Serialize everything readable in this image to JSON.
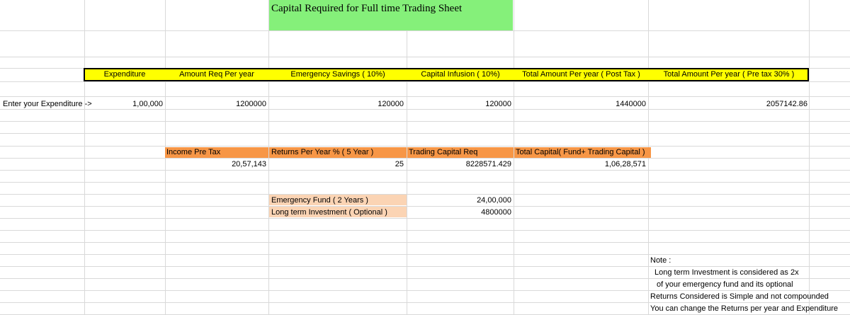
{
  "title": "Capital Required for Full time Trading Sheet",
  "header_row": {
    "expenditure": "Expenditure",
    "amount_req_per_year": "Amount Req Per year",
    "emergency_savings": "Emergency Savings ( 10%)",
    "capital_infusion": "Capital Infusion ( 10%)",
    "total_post_tax": "Total Amount Per year ( Post Tax )",
    "total_pre_tax": "Total Amount Per year ( Pre tax 30% )"
  },
  "values_row": {
    "label": "Enter your Expenditure ->",
    "expenditure": "1,00,000",
    "amount_req_per_year": "1200000",
    "emergency_savings": "120000",
    "capital_infusion": "120000",
    "total_post_tax": "1440000",
    "total_pre_tax": "2057142.86"
  },
  "second_header": {
    "income_pre_tax": "Income Pre Tax",
    "returns_per_year": "Returns Per Year % ( 5 Year )",
    "trading_capital_req": "Trading Capital  Req",
    "total_capital": "Total Capital( Fund+ Trading Capital )"
  },
  "second_values": {
    "income_pre_tax": "20,57,143",
    "returns_per_year": "25",
    "trading_capital_req": "8228571.429",
    "total_capital": "1,06,28,571"
  },
  "funds": {
    "emergency_label": "Emergency Fund ( 2 Years )",
    "emergency_value": "24,00,000",
    "longterm_label": "Long term Investment ( Optional )",
    "longterm_value": "4800000"
  },
  "notes": {
    "heading": "Note :",
    "line1": "Long term Investment is considered as 2x",
    "line2": "of your emergency fund and its optional",
    "line3": "Returns Considered is Simple and not compounded",
    "line4": "You can change the Returns per year and Expenditure"
  },
  "colors": {
    "title_bg": "#85f07a",
    "header_band": "#ffff00",
    "orange_header": "#f79646",
    "peach_fill": "#fbd4b4",
    "gridline": "#d9d9d9"
  }
}
